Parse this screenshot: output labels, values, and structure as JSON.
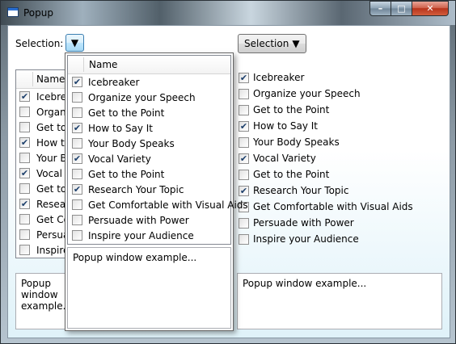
{
  "window": {
    "title": "Popup",
    "caption_buttons": {
      "minimize": "–",
      "maximize": "□",
      "close": "✕"
    }
  },
  "left": {
    "selection_label": "Selection:",
    "dropdown_arrow": "▼",
    "listbox": {
      "header": "Name",
      "rows": [
        {
          "label": "Icebreaker",
          "checked": true
        },
        {
          "label": "Organize your Speech",
          "checked": false
        },
        {
          "label": "Get to the Point",
          "checked": false
        },
        {
          "label": "How to Say It",
          "checked": true
        },
        {
          "label": "Your Body Speaks",
          "checked": false
        },
        {
          "label": "Vocal Variety",
          "checked": true
        },
        {
          "label": "Get to the Point",
          "checked": false
        },
        {
          "label": "Research Your Topic",
          "checked": true
        },
        {
          "label": "Get Comfortable with Visual Aids",
          "checked": false
        },
        {
          "label": "Persuade with Power",
          "checked": false
        },
        {
          "label": "Inspire your Audience",
          "checked": false
        }
      ]
    },
    "textbox_text": "Popup window example..."
  },
  "popup": {
    "header": "Name",
    "rows": [
      {
        "label": "Icebreaker",
        "checked": true
      },
      {
        "label": "Organize your Speech",
        "checked": false
      },
      {
        "label": "Get to the Point",
        "checked": false
      },
      {
        "label": "How to Say It",
        "checked": true
      },
      {
        "label": "Your Body Speaks",
        "checked": false
      },
      {
        "label": "Vocal Variety",
        "checked": true
      },
      {
        "label": "Get to the Point",
        "checked": false
      },
      {
        "label": "Research Your Topic",
        "checked": true
      },
      {
        "label": "Get Comfortable with Visual Aids",
        "checked": false
      },
      {
        "label": "Persuade with Power",
        "checked": false
      },
      {
        "label": "Inspire your Audience",
        "checked": false
      }
    ],
    "text": "Popup window example..."
  },
  "right": {
    "dropdown_label": "Selection",
    "dropdown_arrow": "▼",
    "rows": [
      {
        "label": "Icebreaker",
        "checked": true
      },
      {
        "label": "Organize your Speech",
        "checked": false
      },
      {
        "label": "Get to the Point",
        "checked": false
      },
      {
        "label": "How to Say It",
        "checked": true
      },
      {
        "label": "Your Body Speaks",
        "checked": false
      },
      {
        "label": "Vocal Variety",
        "checked": true
      },
      {
        "label": "Get to the Point",
        "checked": false
      },
      {
        "label": "Research Your Topic",
        "checked": true
      },
      {
        "label": "Get Comfortable with Visual Aids",
        "checked": false
      },
      {
        "label": "Persuade with Power",
        "checked": false
      },
      {
        "label": "Inspire your Audience",
        "checked": false
      }
    ],
    "textbox_text": "Popup window example..."
  },
  "check_glyph": "✔"
}
